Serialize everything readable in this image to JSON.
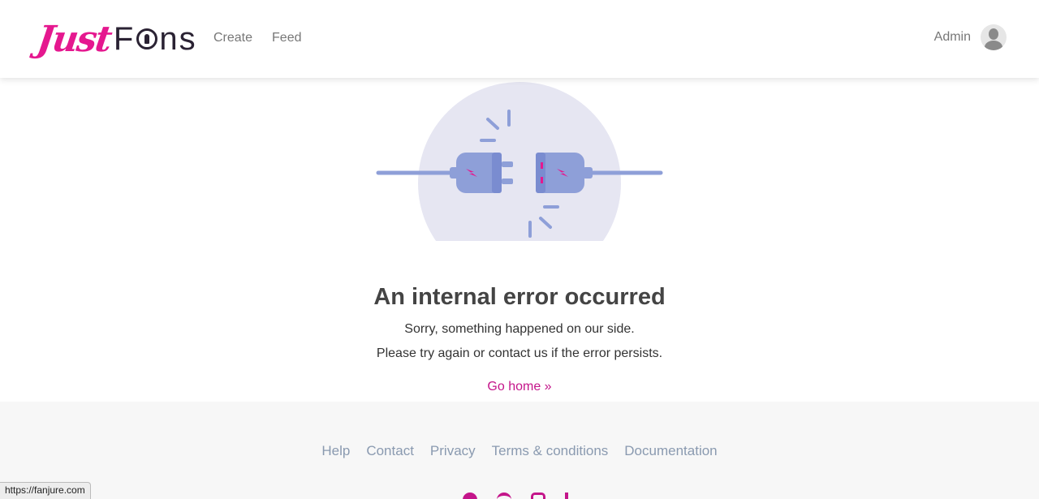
{
  "header": {
    "logo": {
      "part1": "Just",
      "part2_a": "F",
      "part2_b": "ns"
    },
    "nav": [
      {
        "label": "Create"
      },
      {
        "label": "Feed"
      }
    ],
    "user": {
      "name": "Admin"
    }
  },
  "error": {
    "title": "An internal error occurred",
    "message_line1": "Sorry, something happened on our side.",
    "message_line2": "Please try again or contact us if the error persists.",
    "go_home": "Go home »"
  },
  "footer": {
    "links": [
      {
        "label": "Help"
      },
      {
        "label": "Contact"
      },
      {
        "label": "Privacy"
      },
      {
        "label": "Terms & conditions"
      },
      {
        "label": "Documentation"
      }
    ]
  },
  "statusbar": {
    "url": "https://fanjure.com"
  },
  "colors": {
    "accent": "#c4158a",
    "logo_pink": "#e5188f",
    "illustration_bg": "#e6e6f2",
    "plug": "#8e9fd8",
    "footer_link": "#8a9ab0"
  },
  "icons": [
    "unplugged-plug-icon",
    "avatar-icon",
    "social-icons"
  ]
}
